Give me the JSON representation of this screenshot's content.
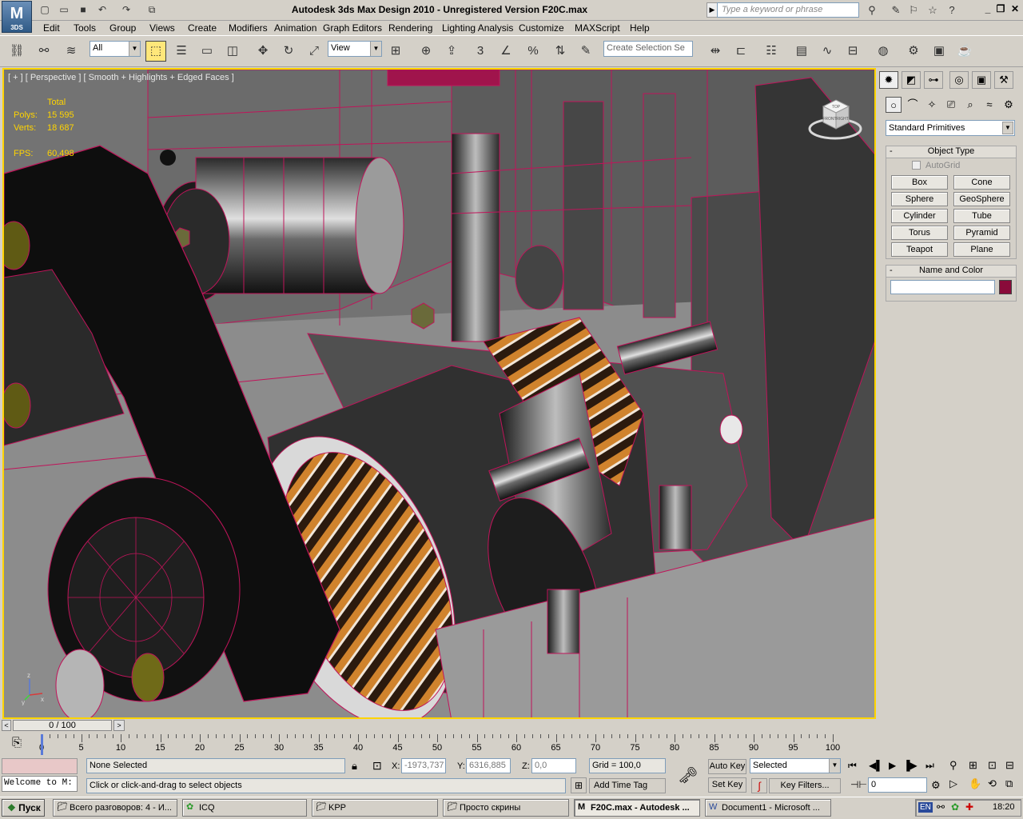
{
  "title": {
    "text": "Autodesk 3ds Max Design 2010   - Unregistered Version    F20C.max",
    "logo_text": "3DS",
    "search_placeholder": "Type a keyword or phrase"
  },
  "menu": [
    "Edit",
    "Tools",
    "Group",
    "Views",
    "Create",
    "Modifiers",
    "Animation",
    "Graph Editors",
    "Rendering",
    "Lighting Analysis",
    "Customize",
    "MAXScript",
    "Help"
  ],
  "toolbar": {
    "filter_value": "All",
    "refcoord_value": "View",
    "selection_set_placeholder": "Create Selection Se",
    "snap_number": "3"
  },
  "viewport": {
    "label": "[ + ] [ Perspective ] [ Smooth + Highlights + Edged Faces ]",
    "stats": {
      "total_label": "Total",
      "polys_label": "Polys:",
      "polys": "15 595",
      "verts_label": "Verts:",
      "verts": "18 687",
      "fps_label": "FPS:",
      "fps": "60,498"
    },
    "viewcube": {
      "front": "FRONT",
      "top": "TOP",
      "right": "RIGHT"
    },
    "axis": {
      "z": "z",
      "x": "x",
      "y": "y"
    }
  },
  "command_panel": {
    "category": "Standard Primitives",
    "object_type_title": "Object Type",
    "autogrid_label": "AutoGrid",
    "primitives": [
      "Box",
      "Cone",
      "Sphere",
      "GeoSphere",
      "Cylinder",
      "Tube",
      "Torus",
      "Pyramid",
      "Teapot",
      "Plane"
    ],
    "name_color_title": "Name and Color",
    "object_color": "#8a0b3a"
  },
  "timeline": {
    "frame_display": "0 / 100",
    "ticks": [
      "0",
      "5",
      "10",
      "15",
      "20",
      "25",
      "30",
      "35",
      "40",
      "45",
      "50",
      "55",
      "60",
      "65",
      "70",
      "75",
      "80",
      "85",
      "90",
      "95",
      "100"
    ]
  },
  "status": {
    "welcome": "Welcome to M:",
    "selection": "None Selected",
    "prompt": "Click or click-and-drag to select objects",
    "x_label": "X:",
    "x": "-1973,737",
    "y_label": "Y:",
    "y": "6316,885",
    "z_label": "Z:",
    "z": "0,0",
    "grid": "Grid = 100,0",
    "add_time_tag": "Add Time Tag",
    "auto_key": "Auto Key",
    "set_key": "Set Key",
    "key_mode": "Selected",
    "key_filters": "Key Filters...",
    "current_frame": "0"
  },
  "taskbar": {
    "start": "Пуск",
    "tasks": [
      "Всего разговоров: 4 - И...",
      "ICQ",
      "KPP",
      "Просто скрины",
      "F20C.max - Autodesk ...",
      "Document1 - Microsoft ..."
    ],
    "lang": "EN",
    "clock": "18:20"
  },
  "colors": {
    "viewport_border": "#ffd400",
    "stats_color": "#ffd400",
    "wire_color": "#d0105a"
  }
}
